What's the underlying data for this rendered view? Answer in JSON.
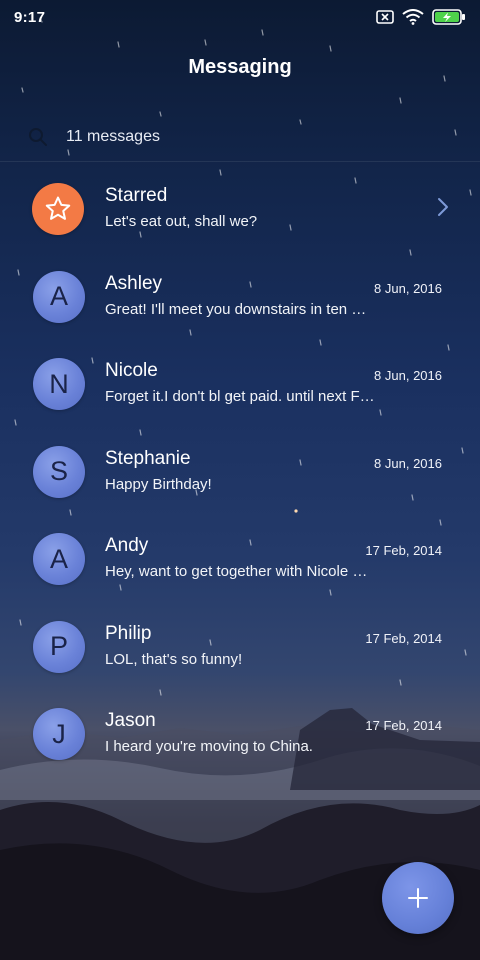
{
  "status_bar": {
    "time": "9:17",
    "icons": [
      "sim-off-icon",
      "wifi-icon",
      "battery-charging-icon"
    ]
  },
  "header": {
    "title": "Messaging"
  },
  "search": {
    "icon": "search-icon",
    "label": "11 messages"
  },
  "conversations": [
    {
      "name": "Starred",
      "preview": "Let's eat out, shall we?",
      "date": "",
      "avatar": "star-icon",
      "avatar_color": "#f37a45"
    },
    {
      "name": "Ashley",
      "preview": "Great! I'll meet you downstairs in ten …",
      "date": "8 Jun, 2016",
      "avatar": "A"
    },
    {
      "name": "Nicole",
      "preview": "Forget it.I don't bl get paid. until next F…",
      "date": "8 Jun, 2016",
      "avatar": "N"
    },
    {
      "name": "Stephanie",
      "preview": "Happy Birthday!",
      "date": "8 Jun, 2016",
      "avatar": "S"
    },
    {
      "name": "Andy",
      "preview": "Hey, want to get together with Nicole …",
      "date": "17 Feb, 2014",
      "avatar": "A"
    },
    {
      "name": "Philip",
      "preview": "LOL, that's so funny!",
      "date": "17 Feb, 2014",
      "avatar": "P"
    },
    {
      "name": "Jason",
      "preview": "I heard you're moving to China.",
      "date": "17 Feb, 2014",
      "avatar": "J"
    }
  ],
  "fab": {
    "icon": "plus-icon"
  },
  "colors": {
    "avatar_blue": "#6a82d8",
    "starred_orange": "#f37a45",
    "fab_blue": "#6580d8"
  }
}
